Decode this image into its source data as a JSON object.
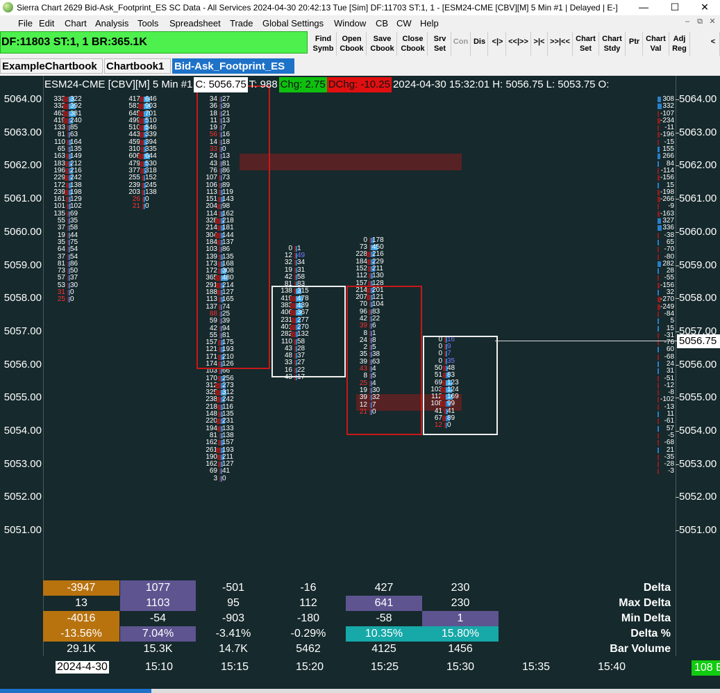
{
  "window": {
    "title": "Sierra Chart 2629 Bid-Ask_Footprint_ES SC Data - All Services 2024-04-30  20:42:13 Tue [Sim] DF:11703  ST:1, 1 - [ESM24-CME [CBV][M]  5 Min  #1 | Delayed | E-]",
    "min": "—",
    "max": "☐",
    "close": "✕"
  },
  "menu": [
    "File",
    "Edit",
    "Chart",
    "Analysis",
    "Tools",
    "Spreadsheet",
    "Trade",
    "Global Settings",
    "Window",
    "CB",
    "CW",
    "Help"
  ],
  "mdi_controls": [
    "–",
    "⧉",
    "✕"
  ],
  "status_box": "DF:11803  ST:1, 1  BR:365.1K",
  "toolbar": [
    {
      "name": "find-symbol-button",
      "l1": "Find",
      "l2": "Symb"
    },
    {
      "name": "open-chartbook-button",
      "l1": "Open",
      "l2": "Cbook"
    },
    {
      "name": "save-chartbook-button",
      "l1": "Save",
      "l2": "Cbook"
    },
    {
      "name": "close-chartbook-button",
      "l1": "Close",
      "l2": "Cbook"
    },
    {
      "name": "server-settings-button",
      "l1": "Srv",
      "l2": "Set"
    },
    {
      "name": "connect-button",
      "l1": "Con",
      "l2": "",
      "dis": true
    },
    {
      "name": "disconnect-button",
      "l1": "Dis",
      "l2": ""
    },
    {
      "name": "scroll-nav-1-button",
      "l1": "<|>",
      "l2": ""
    },
    {
      "name": "scroll-nav-2-button",
      "l1": "<<|>>",
      "l2": ""
    },
    {
      "name": "scroll-nav-3-button",
      "l1": ">|<",
      "l2": ""
    },
    {
      "name": "scroll-nav-4-button",
      "l1": ">>|<<",
      "l2": ""
    },
    {
      "name": "chart-settings-button",
      "l1": "Chart",
      "l2": "Set"
    },
    {
      "name": "chart-studies-button",
      "l1": "Chart",
      "l2": "Stdy"
    },
    {
      "name": "pointer-button",
      "l1": "Ptr",
      "l2": ""
    },
    {
      "name": "chart-values-button",
      "l1": "Chart",
      "l2": "Val"
    },
    {
      "name": "adjust-region-button",
      "l1": "Adj",
      "l2": "Reg"
    },
    {
      "name": "toolbar-scroll-button",
      "l1": "<",
      "l2": ""
    }
  ],
  "tabs": [
    {
      "label": "ExampleChartbook",
      "active": false
    },
    {
      "label": "Chartbook1",
      "active": false
    },
    {
      "label": "Bid-Ask_Footprint_ES",
      "active": true
    }
  ],
  "header": {
    "symbol": "ESM24-CME [CBV][M]  5 Min  #1",
    "close": "C: 5056.75",
    "trades": "T: 988",
    "chg": "Chg: 2.75",
    "dchg": "DChg: -10.25",
    "datetime": "2024-04-30 15:32:01",
    "high": "H: 5056.75",
    "low": "L: 5053.75",
    "open": "O:"
  },
  "price_axis": [
    "5064.00",
    "5063.00",
    "5062.00",
    "5061.00",
    "5060.00",
    "5059.00",
    "5058.00",
    "5057.00",
    "5056.00",
    "5055.00",
    "5054.00",
    "5053.00",
    "5052.00",
    "5051.00"
  ],
  "current_price": "5056.75",
  "time_axis": [
    "2024-4-30",
    "15:10",
    "15:15",
    "15:20",
    "15:25",
    "15:30",
    "15:35",
    "15:40"
  ],
  "colors": {
    "bg": "#16292c",
    "ask_bar": "#2a7fc8",
    "ask_bar_strong": "#3aa4e6",
    "bid_bar": "#8c1c1c",
    "red_text": "#ff3030",
    "blue_text": "#7b7bff",
    "green": "#10cc10",
    "orange": "#b8730f",
    "purple": "#5e5490",
    "teal": "#17a8a8"
  },
  "footprint_bars": [
    {
      "start": 5064.0,
      "rows": [
        [
          "333",
          "322"
        ],
        [
          "332",
          "392"
        ],
        [
          "463",
          "381"
        ],
        [
          "419",
          "240"
        ],
        [
          "133",
          "85"
        ],
        [
          "81",
          "63"
        ],
        [
          "110",
          "164"
        ],
        [
          "65",
          "135"
        ],
        [
          "163",
          "149"
        ],
        [
          "183",
          "212"
        ],
        [
          "196",
          "216"
        ],
        [
          "229",
          "242"
        ],
        [
          "172",
          "138"
        ],
        [
          "239",
          "198"
        ],
        [
          "161",
          "129"
        ],
        [
          "101",
          "102"
        ],
        [
          "135",
          "69"
        ],
        [
          "55",
          "35"
        ],
        [
          "37",
          "58"
        ],
        [
          "19",
          "44"
        ],
        [
          "35",
          "75"
        ],
        [
          "64",
          "54"
        ],
        [
          "37",
          "54"
        ],
        [
          "81",
          "86"
        ],
        [
          "73",
          "50"
        ],
        [
          "57",
          "37"
        ],
        [
          "53",
          "30"
        ],
        [
          "31",
          "0"
        ],
        [
          "25",
          "0"
        ]
      ]
    },
    {
      "start": 5064.0,
      "rows": [
        [
          "417",
          "646"
        ],
        [
          "581",
          "903"
        ],
        [
          "645",
          "701"
        ],
        [
          "499",
          "510"
        ],
        [
          "510",
          "546"
        ],
        [
          "443",
          "339"
        ],
        [
          "459",
          "394"
        ],
        [
          "310",
          "335"
        ],
        [
          "606",
          "644"
        ],
        [
          "479",
          "530"
        ],
        [
          "377",
          "318"
        ],
        [
          "255",
          "152"
        ],
        [
          "239",
          "245"
        ],
        [
          "203",
          "138"
        ],
        [
          "26",
          "0"
        ],
        [
          "21",
          "0"
        ]
      ]
    },
    {
      "start": 5064.0,
      "rows": [
        [
          "34",
          "27"
        ],
        [
          "36",
          "39"
        ],
        [
          "18",
          "21"
        ],
        [
          "11",
          "13"
        ],
        [
          "19",
          "7"
        ],
        [
          "56",
          "16"
        ],
        [
          "14",
          "18"
        ],
        [
          "33",
          "0"
        ],
        [
          "24",
          "13"
        ],
        [
          "43",
          "81"
        ],
        [
          "76",
          "86"
        ],
        [
          "107",
          "73"
        ],
        [
          "106",
          "89"
        ],
        [
          "113",
          "119"
        ],
        [
          "151",
          "143"
        ],
        [
          "204",
          "98"
        ],
        [
          "114",
          "162"
        ],
        [
          "328",
          "218"
        ],
        [
          "214",
          "181"
        ],
        [
          "304",
          "144"
        ],
        [
          "184",
          "137"
        ],
        [
          "103",
          "86"
        ],
        [
          "139",
          "135"
        ],
        [
          "173",
          "168"
        ],
        [
          "172",
          "308"
        ],
        [
          "365",
          "480"
        ],
        [
          "291",
          "214"
        ],
        [
          "188",
          "127"
        ],
        [
          "113",
          "165"
        ],
        [
          "137",
          "74"
        ],
        [
          "88",
          "25"
        ],
        [
          "59",
          "39"
        ],
        [
          "42",
          "94"
        ],
        [
          "55",
          "81"
        ],
        [
          "157",
          "175"
        ],
        [
          "121",
          "193"
        ],
        [
          "171",
          "210"
        ],
        [
          "174",
          "126"
        ],
        [
          "103",
          "66"
        ],
        [
          "170",
          "256"
        ],
        [
          "312",
          "273"
        ],
        [
          "325",
          "312"
        ],
        [
          "238",
          "242"
        ],
        [
          "218",
          "116"
        ],
        [
          "148",
          "135"
        ],
        [
          "220",
          "231"
        ],
        [
          "194",
          "133"
        ],
        [
          "81",
          "138"
        ],
        [
          "162",
          "157"
        ],
        [
          "261",
          "193"
        ],
        [
          "190",
          "211"
        ],
        [
          "162",
          "127"
        ],
        [
          "69",
          "41"
        ],
        [
          "3",
          "0"
        ]
      ]
    },
    {
      "start": 5059.5,
      "rows": [
        [
          "0",
          "1"
        ],
        [
          "12",
          "49"
        ],
        [
          "32",
          "34"
        ],
        [
          "19",
          "31"
        ],
        [
          "42",
          "58"
        ],
        [
          "81",
          "83"
        ],
        [
          "138",
          "315"
        ],
        [
          "419",
          "478"
        ],
        [
          "383",
          "439"
        ],
        [
          "406",
          "367"
        ],
        [
          "231",
          "277"
        ],
        [
          "401",
          "270"
        ],
        [
          "282",
          "132"
        ],
        [
          "110",
          "58"
        ],
        [
          "43",
          "28"
        ],
        [
          "48",
          "37"
        ],
        [
          "33",
          "27"
        ],
        [
          "16",
          "22"
        ],
        [
          "43",
          "17"
        ]
      ]
    },
    {
      "start": 5059.75,
      "rows": [
        [
          "0",
          "178"
        ],
        [
          "73",
          "450"
        ],
        [
          "228",
          "216"
        ],
        [
          "184",
          "229"
        ],
        [
          "152",
          "211"
        ],
        [
          "112",
          "130"
        ],
        [
          "157",
          "128"
        ],
        [
          "214",
          "201"
        ],
        [
          "207",
          "121"
        ],
        [
          "70",
          "104"
        ],
        [
          "96",
          "83"
        ],
        [
          "42",
          "22"
        ],
        [
          "39",
          "6"
        ],
        [
          "8",
          "1"
        ],
        [
          "24",
          "8"
        ],
        [
          "2",
          "5"
        ],
        [
          "35",
          "38"
        ],
        [
          "39",
          "63"
        ],
        [
          "43",
          "4"
        ],
        [
          "8",
          "5"
        ],
        [
          "25",
          "4"
        ],
        [
          "19",
          "30"
        ],
        [
          "39",
          "32"
        ],
        [
          "12",
          "7"
        ],
        [
          "21",
          "0"
        ]
      ]
    },
    {
      "start": 5056.75,
      "rows": [
        [
          "0",
          "16"
        ],
        [
          "0",
          "9"
        ],
        [
          "0",
          "7"
        ],
        [
          "0",
          "35"
        ],
        [
          "50",
          "48"
        ],
        [
          "51",
          "83"
        ],
        [
          "69",
          "123"
        ],
        [
          "103",
          "124"
        ],
        [
          "112",
          "169"
        ],
        [
          "108",
          "99"
        ],
        [
          "41",
          "41"
        ],
        [
          "67",
          "89"
        ],
        [
          "12",
          "0"
        ]
      ]
    }
  ],
  "right_delta_column": [
    "308",
    "332",
    "-107",
    "-234",
    "-11",
    "-196",
    "-15",
    "155",
    "266",
    "84",
    "-114",
    "-156",
    "15",
    "-198",
    "-266",
    "-9",
    "-163",
    "327",
    "336",
    "-38",
    "65",
    "-70",
    "-80",
    "282",
    "28",
    "-55",
    "-156",
    "32",
    "-270",
    "-249",
    "-84",
    "5",
    "15",
    "-31",
    "-76",
    "60",
    "-68",
    "24",
    "31",
    "-51",
    "-12",
    "-8",
    "-102",
    "-13",
    "11",
    "-61",
    "57",
    "-5",
    "-68",
    "21",
    "-35",
    "-28",
    "-3"
  ],
  "stats": {
    "labels": [
      "Delta",
      "Max Delta",
      "Min Delta",
      "Delta %",
      "Bar Volume"
    ],
    "bars": [
      {
        "delta": "-3947",
        "max": "13",
        "min": "-4016",
        "pct": "-13.56%",
        "vol": "29.1K"
      },
      {
        "delta": "1077",
        "max": "1103",
        "min": "-54",
        "pct": "7.04%",
        "vol": "15.3K"
      },
      {
        "delta": "-501",
        "max": "95",
        "min": "-903",
        "pct": "-3.41%",
        "vol": "14.7K"
      },
      {
        "delta": "-16",
        "max": "112",
        "min": "-180",
        "pct": "-0.29%",
        "vol": "5462"
      },
      {
        "delta": "427",
        "max": "641",
        "min": "-58",
        "pct": "10.35%",
        "vol": "4125"
      },
      {
        "delta": "230",
        "max": "230",
        "min": "1",
        "pct": "15.80%",
        "vol": "1456"
      }
    ]
  },
  "volume_badge": "108 B"
}
